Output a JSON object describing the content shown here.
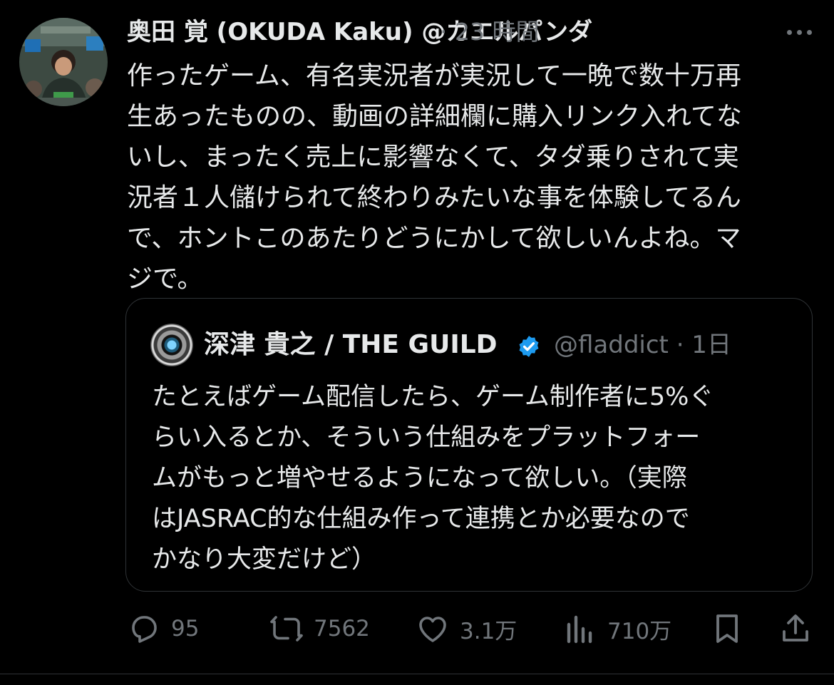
{
  "tweet": {
    "author_name": "奥田 覚 (OKUDA Kaku) @カエルパンダ",
    "meta": "· 23 時間",
    "text": "作ったゲーム、有名実況者が実況して一晩で数十万再\n生あったものの、動画の詳細欄に購入リンク入れてな\nいし、まったく売上に影響なくて、タダ乗りされて実\n況者１人儲けられて終わりみたいな事を体験してるん\nで、ホントこのあたりどうにかして欲しいんよね。マ\nジで。"
  },
  "quote": {
    "author_name": "深津 貴之 / THE GUILD",
    "handle_meta": "@fladdict · 1日",
    "text": "たとえばゲーム配信したら、ゲーム制作者に5%ぐ\nらい入るとか、そういう仕組みをプラットフォー\nムがもっと増やせるようになって欲しい。（実際\nはJASRAC的な仕組み作って連携とか必要なので\nかなり大変だけど）"
  },
  "actions": {
    "replies": "95",
    "retweets": "7562",
    "likes": "3.1万",
    "views": "710万"
  },
  "icons": {
    "more": "more-icon",
    "verified": "verified-badge-icon",
    "reply": "reply-icon",
    "retweet": "retweet-icon",
    "like": "heart-icon",
    "views": "views-icon",
    "bookmark": "bookmark-icon",
    "share": "share-icon"
  },
  "colors": {
    "background": "#000000",
    "text": "#e7e9ea",
    "secondary": "#71767b",
    "border": "#2f3336",
    "verified": "#1d9bf0"
  }
}
